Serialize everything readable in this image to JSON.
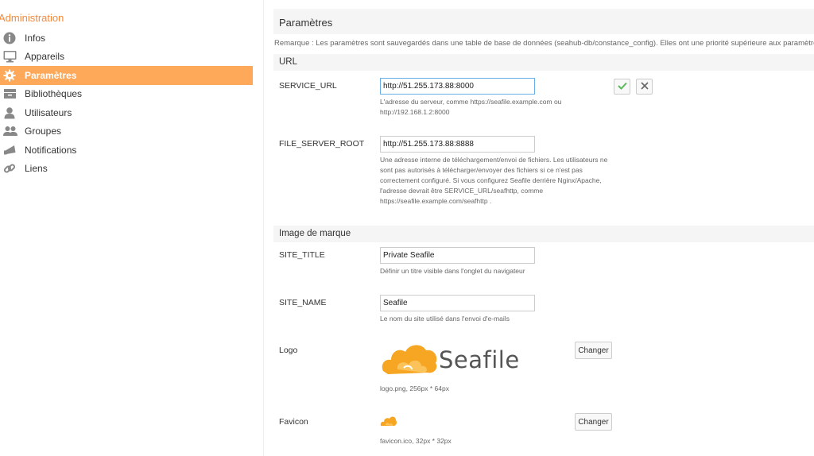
{
  "sidebar": {
    "heading": "Administration",
    "items": [
      {
        "label": "Infos",
        "icon": "info-icon"
      },
      {
        "label": "Appareils",
        "icon": "monitor-icon"
      },
      {
        "label": "Paramètres",
        "icon": "gear-icon",
        "active": true
      },
      {
        "label": "Bibliothèques",
        "icon": "library-icon"
      },
      {
        "label": "Utilisateurs",
        "icon": "user-icon"
      },
      {
        "label": "Groupes",
        "icon": "group-icon"
      },
      {
        "label": "Notifications",
        "icon": "megaphone-icon"
      },
      {
        "label": "Liens",
        "icon": "link-icon"
      }
    ]
  },
  "main": {
    "title": "Paramètres",
    "note": "Remarque : Les paramètres sont sauvegardés dans une table de base de données (seahub-db/constance_config). Elles ont une priorité supérieure aux paramètres des fichiers",
    "sections": {
      "url": {
        "heading": "URL",
        "service_url": {
          "key": "SERVICE_URL",
          "value": "http://51.255.173.88:8000",
          "help": "L'adresse du serveur, comme https://seafile.example.com ou http://192.168.1.2:8000"
        },
        "file_server_root": {
          "key": "FILE_SERVER_ROOT",
          "value": "http://51.255.173.88:8888",
          "help": "Une adresse interne de téléchargement/envoi de fichiers. Les utilisateurs ne sont pas autorisés à télécharger/envoyer des fichiers si ce n'est pas correctement configuré. Si vous configurez Seafile derrière Nginx/Apache, l'adresse devrait être SERVICE_URL/seafhttp, comme https://seafile.example.com/seafhttp ."
        }
      },
      "branding": {
        "heading": "Image de marque",
        "site_title": {
          "key": "SITE_TITLE",
          "value": "Private Seafile",
          "help": "Définir un titre visible dans l'onglet du navigateur"
        },
        "site_name": {
          "key": "SITE_NAME",
          "value": "Seafile",
          "help": "Le nom du site utilisé dans l'envoi d'e-mails"
        },
        "logo": {
          "key": "Logo",
          "wordmark": "Seafile",
          "info": "logo.png, 256px * 64px",
          "button": "Changer"
        },
        "favicon": {
          "key": "Favicon",
          "info": "favicon.ico, 32px * 32px",
          "button": "Changer"
        }
      }
    }
  },
  "colors": {
    "accent": "#f7893a",
    "active_bg": "#fea859",
    "logo_orange": "#f6a623",
    "confirm_green": "#5cb85c"
  }
}
